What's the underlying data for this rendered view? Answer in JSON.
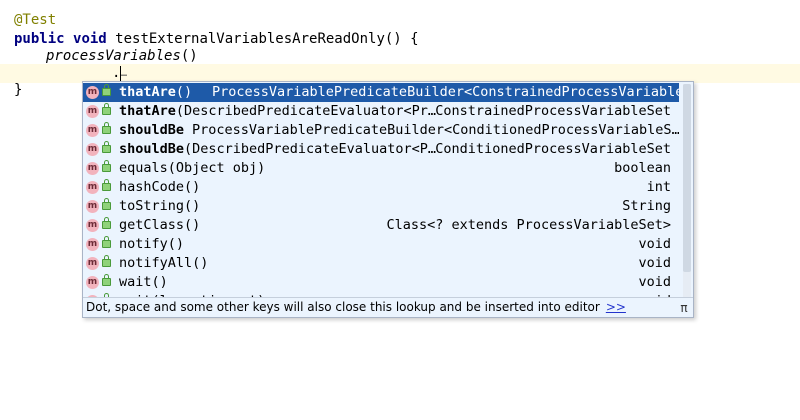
{
  "editor": {
    "lines": [
      {
        "annotation": "@Test"
      },
      {
        "kw1": "public",
        "kw2": "void",
        "rest": " testExternalVariablesAreReadOnly() {"
      },
      {
        "italic": "processVariables",
        "rest": "()"
      },
      {
        "caret_text": "."
      },
      {
        "text": "}"
      }
    ],
    "caret_suffix": "…"
  },
  "completion": {
    "items": [
      {
        "icon": "method-icon",
        "name_bold": "thatAre",
        "name_rest": "()",
        "mid": "ProcessVariablePredicateBuilder<ConstrainedProcessVariableSet>",
        "type": "",
        "selected": true
      },
      {
        "icon": "method-icon",
        "name_bold": "thatAre",
        "name_rest": "(DescribedPredicateEvaluator<Pr…",
        "mid": "",
        "type": "ConstrainedProcessVariableSet",
        "selected": false
      },
      {
        "icon": "method-icon",
        "name_bold": "shouldBe",
        "name_rest": "",
        "mid2": "ProcessVariablePredicateBuilder<ConditionedProcessVariableS…",
        "type": "",
        "selected": false
      },
      {
        "icon": "method-icon",
        "name_bold": "shouldBe",
        "name_rest": "(DescribedPredicateEvaluator<P…",
        "mid": "",
        "type": "ConditionedProcessVariableSet",
        "selected": false
      },
      {
        "icon": "method-icon",
        "name_bold": "",
        "name_rest": "equals(Object obj)",
        "mid": "",
        "type": "boolean",
        "selected": false
      },
      {
        "icon": "method-icon",
        "name_bold": "",
        "name_rest": "hashCode()",
        "mid": "",
        "type": "int",
        "selected": false
      },
      {
        "icon": "method-icon",
        "name_bold": "",
        "name_rest": "toString()",
        "mid": "",
        "type": "String",
        "selected": false
      },
      {
        "icon": "method-icon",
        "name_bold": "",
        "name_rest": "getClass()",
        "mid": "",
        "type": "Class<? extends ProcessVariableSet>",
        "selected": false
      },
      {
        "icon": "method-icon",
        "name_bold": "",
        "name_rest": "notify()",
        "mid": "",
        "type": "void",
        "selected": false
      },
      {
        "icon": "method-icon",
        "name_bold": "",
        "name_rest": "notifyAll()",
        "mid": "",
        "type": "void",
        "selected": false
      },
      {
        "icon": "method-icon",
        "name_bold": "",
        "name_rest": "wait()",
        "mid": "",
        "type": "void",
        "selected": false
      },
      {
        "icon": "method-icon",
        "name_bold": "",
        "name_rest": "wait(long timeout)",
        "mid": "",
        "type": "void",
        "selected": false
      }
    ],
    "footer_text": "Dot, space and some other keys will also close this lookup and be inserted into editor",
    "footer_link": ">>",
    "pi_label": "π"
  },
  "colors": {
    "selected_bg": "#1e5aa8",
    "popup_bg": "#ebf4fe",
    "annotation": "#808000",
    "keyword": "#000080"
  }
}
